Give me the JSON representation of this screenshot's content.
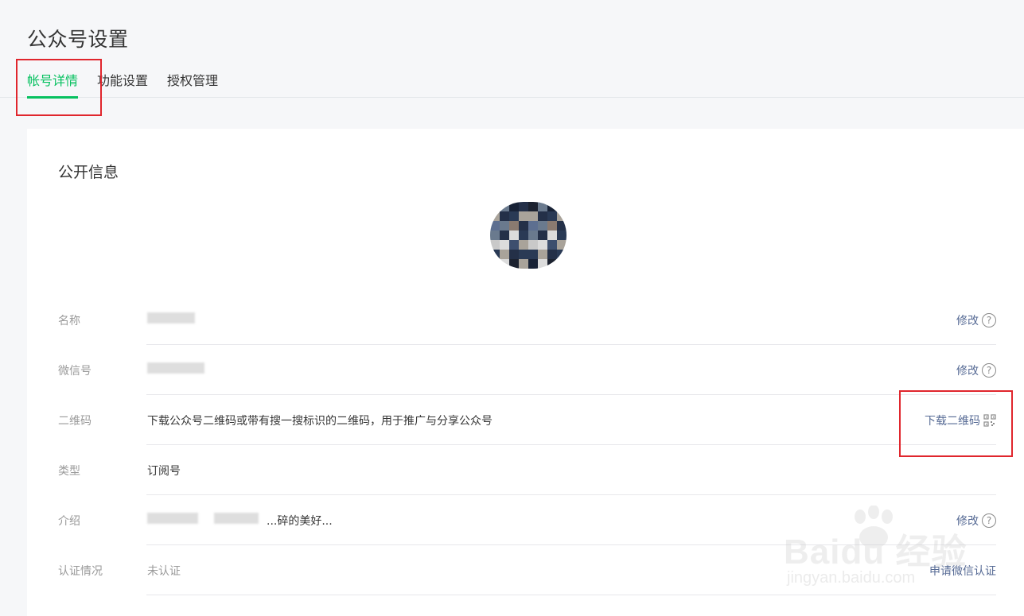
{
  "page": {
    "title": "公众号设置"
  },
  "tabs": [
    {
      "label": "帐号详情",
      "active": true
    },
    {
      "label": "功能设置",
      "active": false
    },
    {
      "label": "授权管理",
      "active": false
    }
  ],
  "card": {
    "section_title": "公开信息",
    "rows": [
      {
        "label": "名称",
        "value": "",
        "action": "修改"
      },
      {
        "label": "微信号",
        "value": "",
        "action": "修改"
      },
      {
        "label": "二维码",
        "value": "下载公众号二维码或带有搜一搜标识的二维码，用于推广与分享公众号",
        "action": "下载二维码"
      },
      {
        "label": "类型",
        "value": "订阅号",
        "action": ""
      },
      {
        "label": "介绍",
        "value": "...碎的美好...",
        "action": "修改"
      },
      {
        "label": "认证情况",
        "value": "未认证",
        "action": "申请微信认证"
      }
    ]
  },
  "watermark": {
    "logo": "Baidu 经验",
    "url": "jingyan.baidu.com"
  },
  "colors": {
    "accent": "#07c160",
    "link": "#576b95",
    "highlight": "#e0262d"
  },
  "icons": {
    "help": "help-icon",
    "qr": "qr-code-icon"
  }
}
